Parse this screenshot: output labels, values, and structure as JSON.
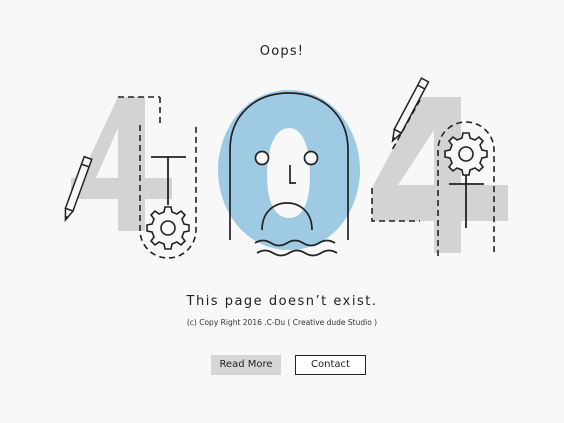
{
  "heading": "Oops!",
  "message": "This page doesn’t exist.",
  "copyright": "(c) Copy Right 2016 .C-Du ( Creative dude Studio )",
  "buttons": {
    "read_more": "Read More",
    "contact": "Contact"
  },
  "colors": {
    "background": "#f8f8f8",
    "digit_gray": "#d3d3d3",
    "zero_blue": "#9ecbe3",
    "line": "#222222"
  },
  "icons": [
    "pencil-icon",
    "gear-icon",
    "sad-face-icon",
    "wave-icon"
  ]
}
